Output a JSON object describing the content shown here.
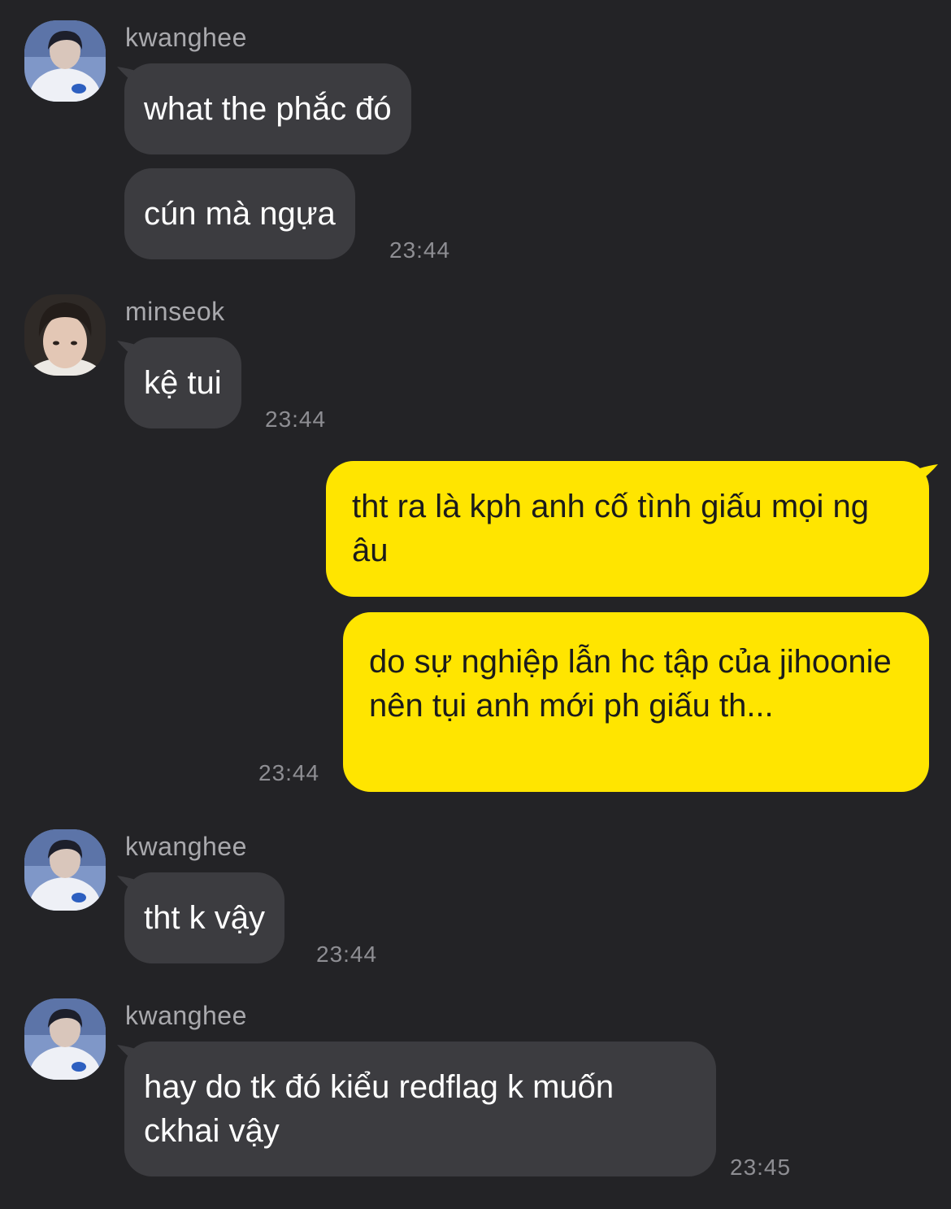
{
  "chat": {
    "groups": [
      {
        "sender": "kwanghee",
        "avatar_icon": "profile-photo-kwanghee",
        "messages": [
          "what the phắc đó",
          "cún mà ngựa"
        ],
        "time": "23:44"
      },
      {
        "sender": "minseok",
        "avatar_icon": "profile-photo-minseok",
        "messages": [
          "kệ tui"
        ],
        "time": "23:44"
      },
      {
        "sender": "me",
        "messages": [
          "tht ra là kph anh cố tình giấu mọi ng âu",
          "do sự nghiệp lẫn hc tập của jihoonie nên tụi anh mới ph giấu th..."
        ],
        "time": "23:44"
      },
      {
        "sender": "kwanghee",
        "avatar_icon": "profile-photo-kwanghee",
        "messages": [
          "tht k vậy"
        ],
        "time": "23:44"
      },
      {
        "sender": "kwanghee",
        "avatar_icon": "profile-photo-kwanghee",
        "messages": [
          "hay do tk đó kiểu redflag k muốn ckhai vậy"
        ],
        "time": "23:45"
      }
    ]
  },
  "colors": {
    "background": "#232326",
    "incoming_bubble": "#3c3c40",
    "outgoing_bubble": "#ffe500",
    "sender_name": "#a9a9ad",
    "timestamp": "#8e8e93"
  }
}
